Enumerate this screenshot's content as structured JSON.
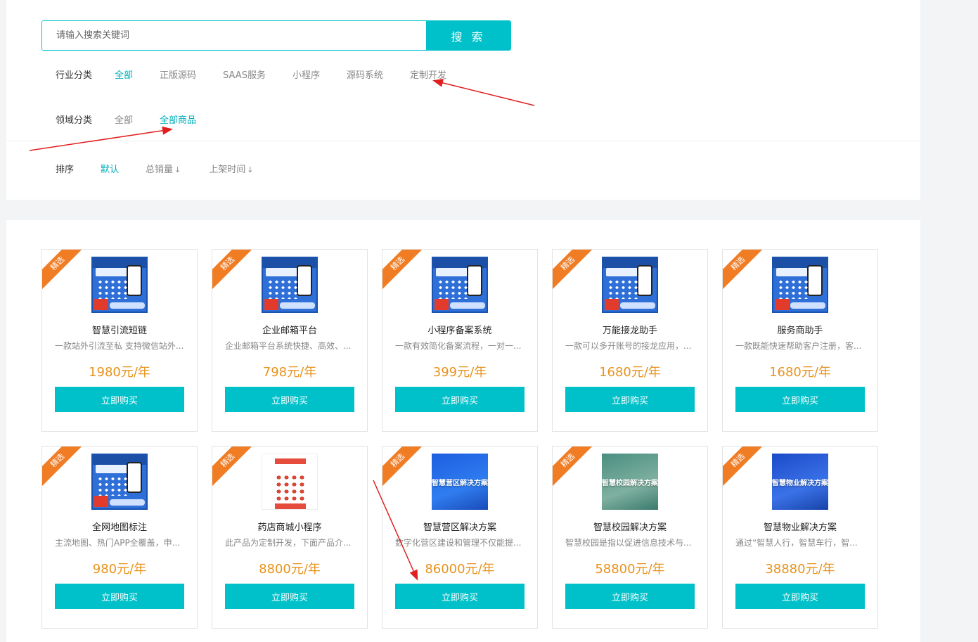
{
  "search": {
    "placeholder": "请输入搜索关键词",
    "button_label": "搜 索"
  },
  "filters": {
    "industry": {
      "label": "行业分类",
      "options": [
        "全部",
        "正版源码",
        "SAAS服务",
        "小程序",
        "源码系统",
        "定制开发"
      ],
      "active": "全部"
    },
    "domain": {
      "label": "领域分类",
      "options": [
        "全部",
        "全部商品"
      ],
      "active": "全部商品"
    },
    "sort": {
      "label": "排序",
      "options": [
        "默认",
        "总销量",
        "上架时间"
      ],
      "active": "默认",
      "arrow": "↓"
    }
  },
  "badge_label": "精选",
  "buy_label": "立即购买",
  "products": [
    {
      "name": "智慧引流短链",
      "desc": "一款站外引流至私 支持微信站外...",
      "price": "1980元/年",
      "thumb": "app"
    },
    {
      "name": "企业邮箱平台",
      "desc": "企业邮箱平台系统快捷、高效、...",
      "price": "798元/年",
      "thumb": "app"
    },
    {
      "name": "小程序备案系统",
      "desc": "一款有效简化备案流程，一对一...",
      "price": "399元/年",
      "thumb": "app"
    },
    {
      "name": "万能接龙助手",
      "desc": "一款可以多开账号的接龙应用，...",
      "price": "1680元/年",
      "thumb": "app"
    },
    {
      "name": "服务商助手",
      "desc": "一款既能快速帮助客户注册，客...",
      "price": "1680元/年",
      "thumb": "app"
    },
    {
      "name": "全网地图标注",
      "desc": "主流地图、热门APP全覆盖，申...",
      "price": "980元/年",
      "thumb": "app"
    },
    {
      "name": "药店商城小程序",
      "desc": "此产品为定制开发，下面产品介...",
      "price": "8800元/年",
      "thumb": "shop"
    },
    {
      "name": "智慧营区解决方案",
      "desc": "数字化营区建设和管理不仅能提...",
      "price": "86000元/年",
      "thumb": "sol-blue",
      "thumb_text": "智慧营区解决方案"
    },
    {
      "name": "智慧校园解决方案",
      "desc": "智慧校园是指以促进信息技术与...",
      "price": "58800元/年",
      "thumb": "sol-green",
      "thumb_text": "智慧校园解决方案"
    },
    {
      "name": "智慧物业解决方案",
      "desc": "通过“智慧人行，智慧车行，智...",
      "price": "38880元/年",
      "thumb": "sol-navy",
      "thumb_text": "智慧物业解决方案"
    }
  ],
  "colors": {
    "accent": "#00c1c9",
    "price": "#e8931e",
    "ribbon": "#f07c24",
    "annotation_arrow": "#e02020"
  }
}
